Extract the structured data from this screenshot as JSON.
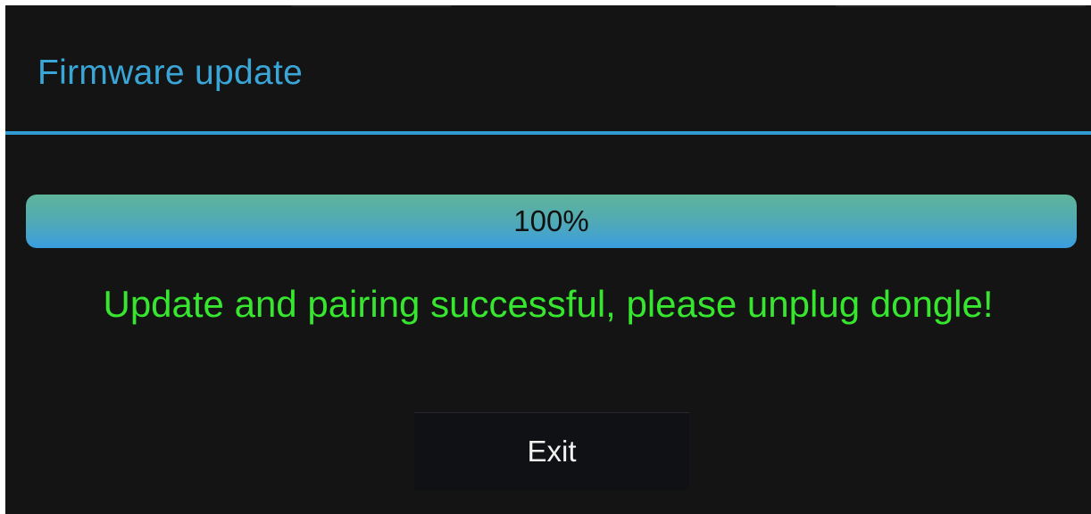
{
  "dialog": {
    "title": "Firmware update",
    "accent_color": "#3aa6d8",
    "progress": {
      "value_percent": 100,
      "label": "100%"
    },
    "status_message": "Update and pairing successful, please unplug dongle!",
    "status_color": "#37e62e",
    "exit_label": "Exit"
  }
}
